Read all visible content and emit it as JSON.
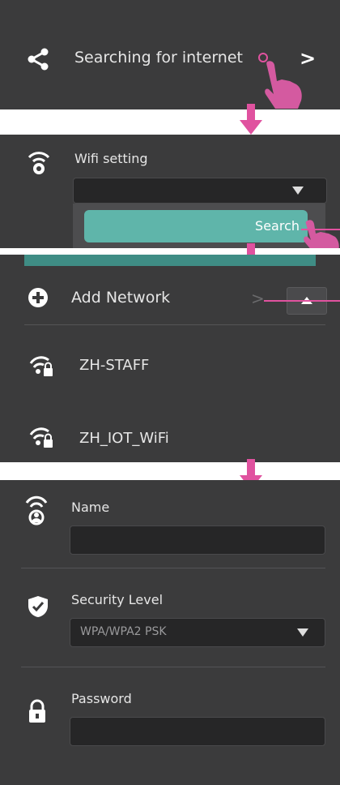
{
  "panel1": {
    "label": "Searching for internet",
    "chevron": ">"
  },
  "panel2": {
    "title": "Wifi setting",
    "search_label": "Search"
  },
  "panel3": {
    "add_network": "Add Network",
    "chevron": ">",
    "networks": [
      {
        "name": "ZH-STAFF"
      },
      {
        "name": "ZH_IOT_WiFi"
      }
    ]
  },
  "panel4": {
    "name_label": "Name",
    "name_value": "",
    "security_label": "Security Level",
    "security_value": "WPA/WPA2 PSK",
    "password_label": "Password",
    "password_value": ""
  },
  "colors": {
    "panel_bg": "#3b3b3c",
    "accent_pink": "#e0529f",
    "search_teal": "#5fb5aa",
    "field_bg": "#262627"
  },
  "icons": [
    "share-icon",
    "chevron-right-icon",
    "touch-hand-icon",
    "arrow-down-icon",
    "wifi-gear-icon",
    "dropdown-triangle-icon",
    "plus-circle-icon",
    "wifi-lock-icon",
    "wifi-user-icon",
    "shield-check-icon",
    "padlock-icon"
  ]
}
